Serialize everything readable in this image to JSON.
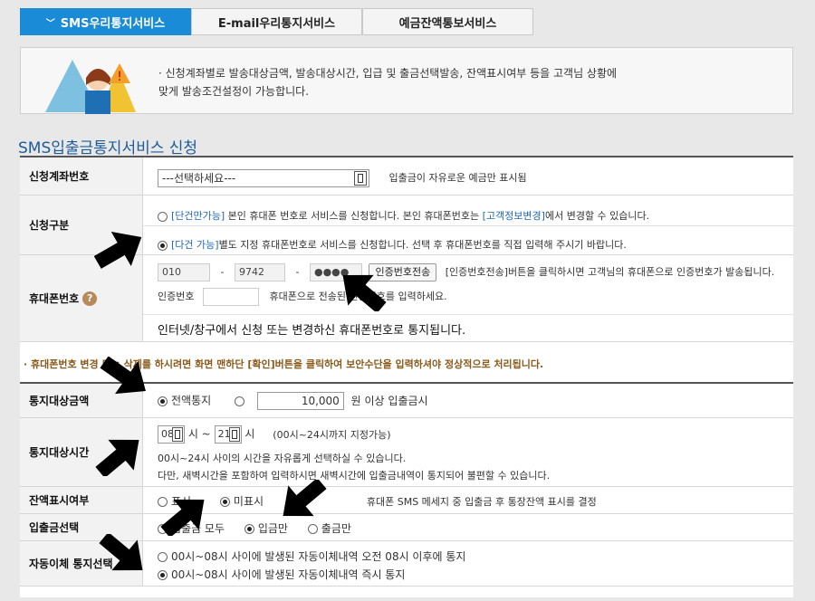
{
  "tabs": [
    {
      "label": "SMS우리통지서비스",
      "active": true
    },
    {
      "label": "E-mail우리통지서비스",
      "active": false
    },
    {
      "label": "예금잔액통보서비스",
      "active": false
    }
  ],
  "info": {
    "line1": "· 신청계좌별로 발송대상금액, 발송대상시간, 입급 및 출금선택발송, 잔액표시여부 등을 고객님 상황에",
    "line2": "  맞게 발송조건설정이 가능합니다."
  },
  "section_title": "SMS입출금통지서비스 신청",
  "form": {
    "account": {
      "label": "신청계좌번호",
      "select_value": "---선택하세요---",
      "hint": "입출금이 자유로운 예금만 표시됨"
    },
    "apply_type": {
      "label": "신청구분",
      "option1_badge": "[단건만가능]",
      "option1_text": " 본인 휴대폰 번호로 서비스를 신청합니다. 본인 휴대폰번호는 ",
      "option1_link": "[고객정보변경]",
      "option1_tail": "에서 변경할 수 있습니다.",
      "option2_badge": "[다건 가능]",
      "option2_text": "별도 지정 휴대폰번호로 서비스를 신청합니다. 선택 후 휴대폰번호를 직접 입력해 주시기 바랍니다."
    },
    "phone": {
      "label": "휴대폰번호",
      "p1": "010",
      "p2": "9742",
      "p3": "●●●●",
      "dash": "-",
      "send_button": "인증번호전송",
      "send_hint": "[인증번호전송]버튼을 클릭하시면 고객님의 휴대폰으로 인증번호가 발송됩니다.",
      "code_label": "인증번호",
      "code_hint": "휴대폰으로 전송된 인증번호를 입력하세요.",
      "note": "인터넷/창구에서 신청 또는 변경하신 휴대폰번호로 통지됩니다."
    },
    "notice": "· 휴대폰번호 변경 또는 삭제를 하시려면 화면 맨하단 [확인]버튼을 클릭하여 보안수단을 입력하셔야 정상적으로 처리됩니다.",
    "amount": {
      "label": "통지대상금액",
      "opt_all": "전액통지",
      "value": "10,000",
      "suffix": "원 이상 입출금시"
    },
    "time": {
      "label": "통지대상시간",
      "from": "08",
      "from_unit": "시 ~",
      "to": "21",
      "to_unit": "시",
      "range_hint": "(00시~24시까지 지정가능)",
      "desc1": "00시~24시 사이의 시간을 자유롭게 선택하실 수 있습니다.",
      "desc2": "다만, 새벽시간을 포함하여 입력하시면 새벽시간에 입출금내역이 통지되어 불편할 수 있습니다."
    },
    "balance": {
      "label": "잔액표시여부",
      "opt_show": "표시",
      "opt_hide": "미표시",
      "hint": "휴대폰 SMS 메세지 중 입출금 후 통장잔액 표시를 결정"
    },
    "inout": {
      "label": "입출금선택",
      "opt_both": "입출금 모두",
      "opt_in": "입금만",
      "opt_out": "출금만"
    },
    "auto": {
      "label": "자동이체 통지선택",
      "opt1": "00시~08시 사이에 발생된 자동이체내역 오전 08시 이후에 통지",
      "opt2": "00시~08시 사이에 발생된 자동이체내역 즉시 통지"
    }
  },
  "colors": {
    "accent": "#1a8bd6",
    "title": "#1e5c99",
    "notice": "#8a5a1a"
  }
}
